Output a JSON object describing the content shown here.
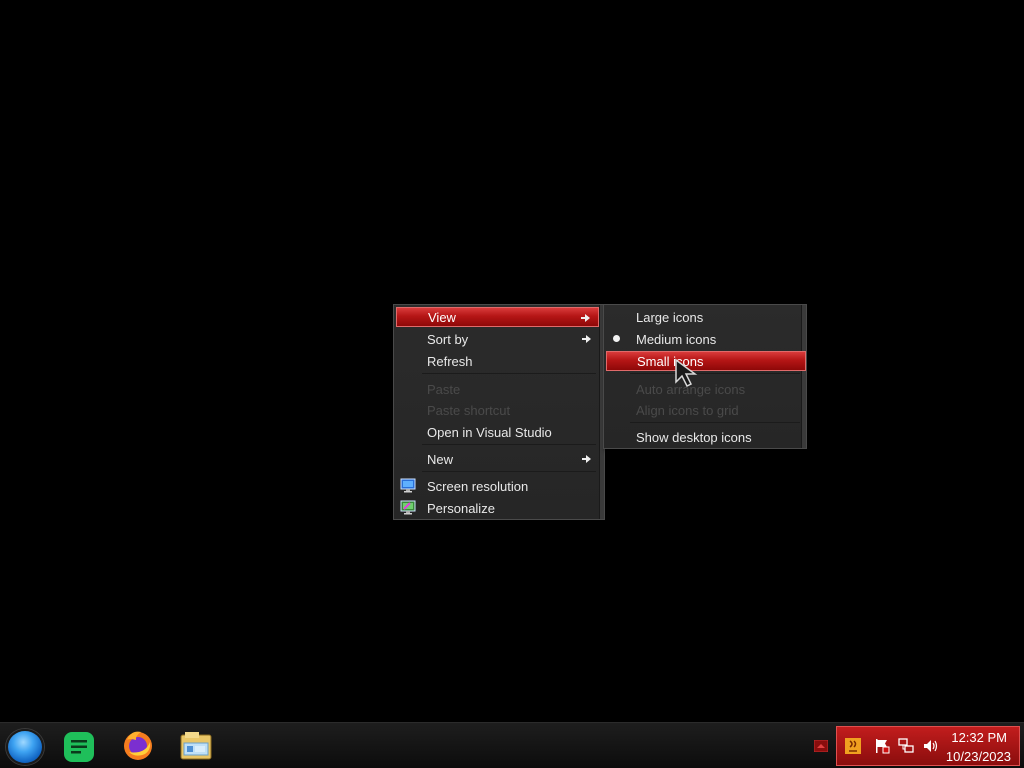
{
  "context_menu": {
    "items": [
      {
        "label": "View",
        "submenu": true,
        "highlighted": true
      },
      {
        "label": "Sort by",
        "submenu": true
      },
      {
        "label": "Refresh"
      },
      {
        "label": "Paste",
        "disabled": true
      },
      {
        "label": "Paste shortcut",
        "disabled": true
      },
      {
        "label": "Open in Visual Studio"
      },
      {
        "label": "New",
        "submenu": true
      },
      {
        "label": "Screen resolution",
        "icon": "screen-resolution-icon"
      },
      {
        "label": "Personalize",
        "icon": "personalize-icon"
      }
    ]
  },
  "view_submenu": {
    "items": [
      {
        "label": "Large icons"
      },
      {
        "label": "Medium icons",
        "selected": true
      },
      {
        "label": "Small icons",
        "highlighted": true
      },
      {
        "label": "Auto arrange icons",
        "disabled": true
      },
      {
        "label": "Align icons to grid",
        "disabled": true
      },
      {
        "label": "Show desktop icons"
      }
    ]
  },
  "taskbar": {
    "apps": [
      "start-orb",
      "notes-app-icon",
      "firefox-icon",
      "file-explorer-icon"
    ],
    "clock": {
      "time": "12:32 PM",
      "date": "10/23/2023"
    }
  },
  "theme": {
    "accent": "#b51616",
    "menu_bg": "#2a2a2a"
  }
}
